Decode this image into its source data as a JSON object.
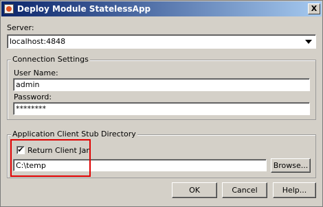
{
  "window": {
    "title": "Deploy Module StatelessApp",
    "close_label": "X"
  },
  "server": {
    "label": "Server:",
    "value": "localhost:4848"
  },
  "connection": {
    "group_title": "Connection Settings",
    "username_label": "User Name:",
    "username_value": "admin",
    "password_label": "Password:",
    "password_value": "********"
  },
  "stub": {
    "group_title": "Application Client Stub Directory",
    "checkbox_label": "Return Client Jar",
    "checkbox_mark": "✔",
    "path_value": "C:\\temp",
    "browse_label": "Browse..."
  },
  "buttons": {
    "ok": "OK",
    "cancel": "Cancel",
    "help": "Help..."
  },
  "colors": {
    "highlight": "#e00000",
    "titlebar": "#0a246a",
    "face": "#d4d0c8"
  }
}
